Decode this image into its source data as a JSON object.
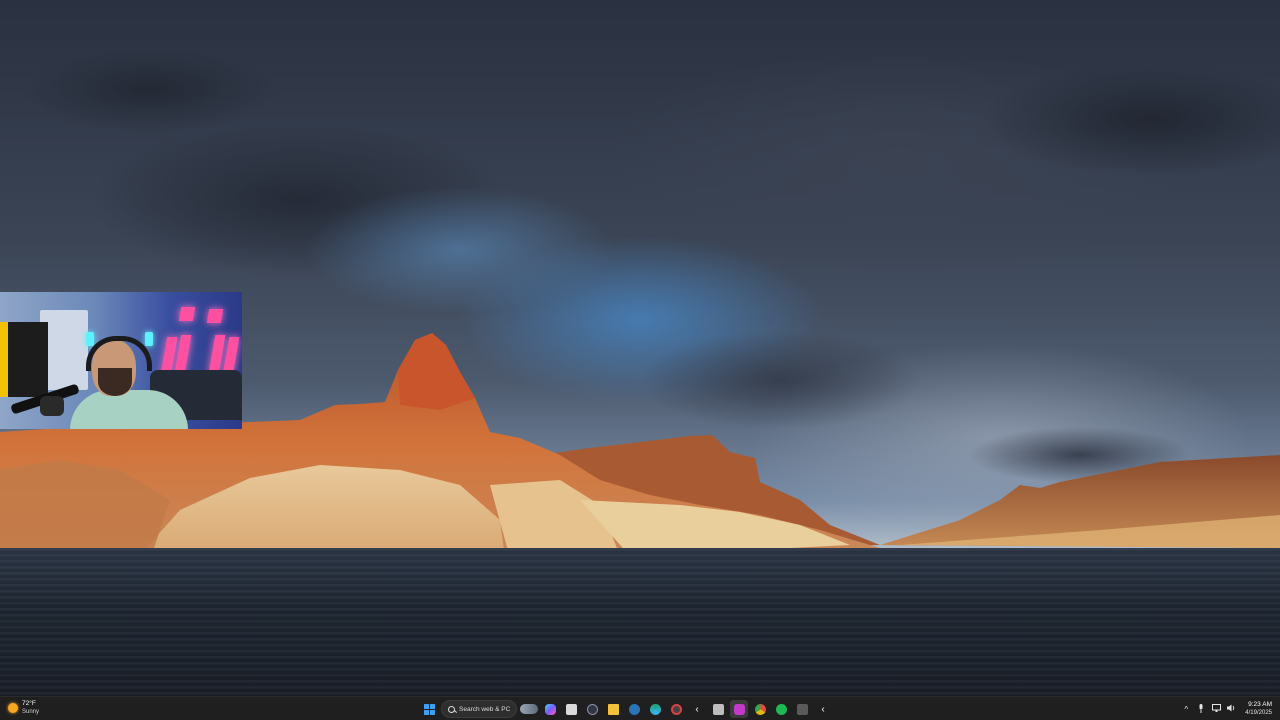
{
  "taskbar": {
    "weather": {
      "temperature": "72°F",
      "condition": "Sunny",
      "icon": "sun-icon"
    },
    "search": {
      "placeholder": "Search web & PC",
      "icon": "search-icon"
    },
    "pinned_apps": [
      {
        "name": "start-button-windows-icon",
        "color": "#3aa0f0"
      },
      {
        "name": "widget-pill-icon",
        "color": "#8a97a8"
      },
      {
        "name": "copilot-icon",
        "color": "#7b5cff"
      },
      {
        "name": "notepad-icon",
        "color": "#d9d9d9"
      },
      {
        "name": "obs-icon",
        "color": "#303545"
      },
      {
        "name": "file-explorer-icon",
        "color": "#f2c23a"
      },
      {
        "name": "steam-icon",
        "color": "#2a75b8"
      },
      {
        "name": "edge-icon",
        "color": "#1fa37a"
      },
      {
        "name": "recording-app-icon",
        "color": "#d64545"
      },
      {
        "name": "arrow-app-icon",
        "color": "#ffffff"
      },
      {
        "name": "calculator-app-icon",
        "color": "#bdbdbd"
      },
      {
        "name": "discord-icon",
        "color": "#c23ac8"
      },
      {
        "name": "chrome-icon",
        "color": "#e2b714"
      },
      {
        "name": "spotify-icon",
        "color": "#1db954"
      },
      {
        "name": "excel-icon",
        "color": "#5a5a5a"
      },
      {
        "name": "arrow-app-icon-2",
        "color": "#ffffff"
      }
    ],
    "tray": {
      "chevron": "^",
      "clock_time": "9:23 AM",
      "clock_date": "4/19/2025"
    }
  }
}
